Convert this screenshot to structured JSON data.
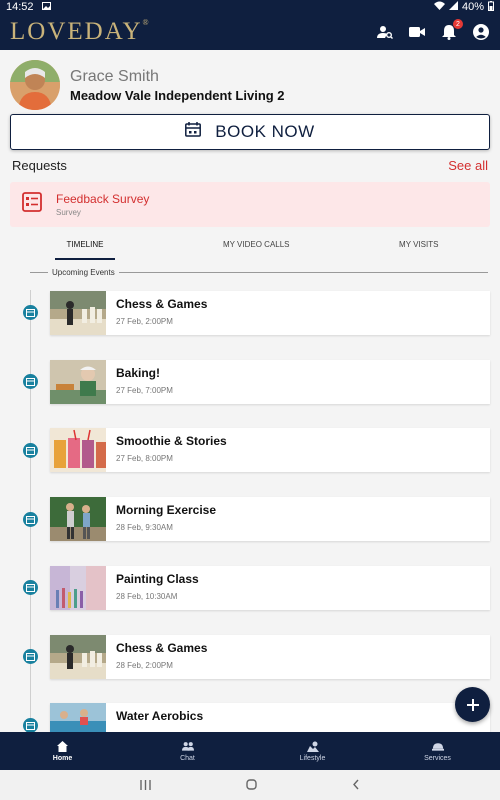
{
  "status_bar": {
    "time": "14:52",
    "battery": "40%"
  },
  "app": {
    "logo": "LOVEDAY",
    "logo_mark": "®"
  },
  "header_icons": {
    "notification_count": "2"
  },
  "profile": {
    "name": "Grace Smith",
    "location": "Meadow Vale Independent Living 2"
  },
  "book_button": {
    "label": "BOOK NOW"
  },
  "requests": {
    "title": "Requests",
    "see_all": "See all",
    "survey_title": "Feedback Survey",
    "survey_subtitle": "Survey"
  },
  "tabs": [
    {
      "label": "TIMELINE",
      "active": true
    },
    {
      "label": "MY VIDEO CALLS",
      "active": false
    },
    {
      "label": "MY VISITS",
      "active": false
    }
  ],
  "timeline": {
    "section_label": "Upcoming Events",
    "events": [
      {
        "title": "Chess & Games",
        "date": "27 Feb, 2:00PM"
      },
      {
        "title": "Baking!",
        "date": "27 Feb, 7:00PM"
      },
      {
        "title": "Smoothie & Stories",
        "date": "27 Feb, 8:00PM"
      },
      {
        "title": "Morning Exercise",
        "date": "28 Feb, 9:30AM"
      },
      {
        "title": "Painting Class",
        "date": "28 Feb, 10:30AM"
      },
      {
        "title": "Chess & Games",
        "date": "28 Feb, 2:00PM"
      },
      {
        "title": "Water Aerobics",
        "date": ""
      }
    ]
  },
  "bottom_nav": [
    {
      "label": "Home",
      "icon": "home-icon",
      "active": true
    },
    {
      "label": "Chat",
      "icon": "people-icon",
      "active": false
    },
    {
      "label": "Lifestyle",
      "icon": "lifestyle-icon",
      "active": false
    },
    {
      "label": "Services",
      "icon": "services-icon",
      "active": false
    }
  ],
  "colors": {
    "navy": "#0f1f3f",
    "accent_red": "#d32f2f",
    "teal": "#19819f",
    "gold": "#c9b37a"
  }
}
